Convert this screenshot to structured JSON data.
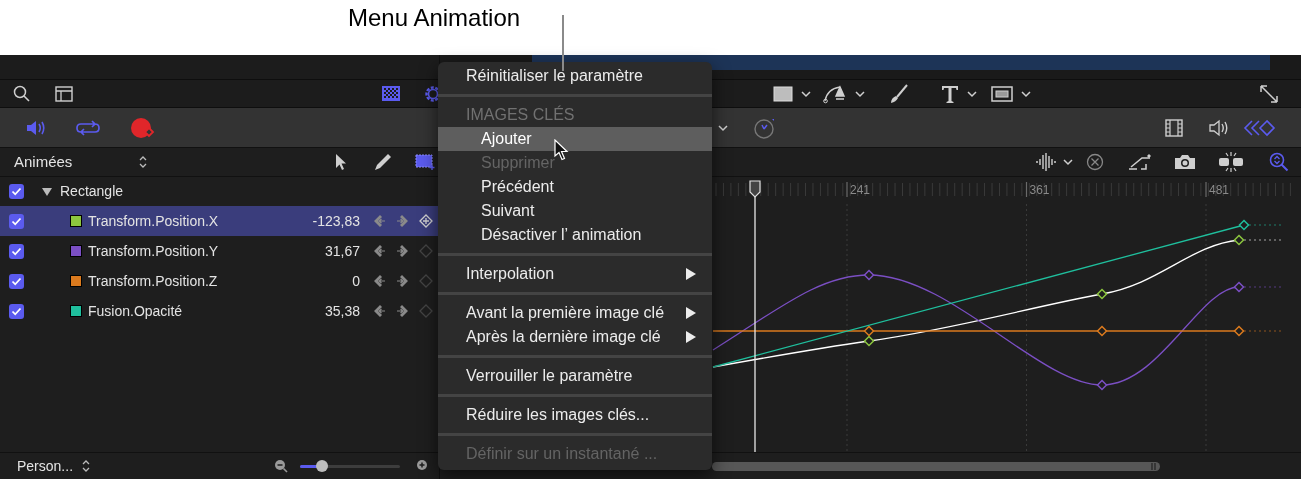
{
  "callout": {
    "label": "Menu Animation"
  },
  "parameter_list": {
    "filter": "Animées",
    "group": {
      "name": "Rectangle",
      "checked": true,
      "expanded": true
    },
    "parameters": [
      {
        "name": "Transform.Position.X",
        "value": "-123,83",
        "color": "#8cc63e",
        "checked": true,
        "selected": true
      },
      {
        "name": "Transform.Position.Y",
        "value": "31,67",
        "color": "#7b4fc4",
        "checked": true,
        "selected": false
      },
      {
        "name": "Transform.Position.Z",
        "value": "0",
        "color": "#db7a1e",
        "checked": true,
        "selected": false
      },
      {
        "name": "Fusion.Opacité",
        "value": "35,38",
        "color": "#1fbf9d",
        "checked": true,
        "selected": false
      }
    ]
  },
  "bottom_bar": {
    "preset": "Person...",
    "zoom": {
      "level": 0.22
    }
  },
  "ruler": {
    "labels": [
      "241",
      "361",
      "481"
    ]
  },
  "menu": [
    {
      "kind": "item",
      "label": "Réinitialiser le paramètre",
      "selected": false,
      "disabled": false,
      "submenu": false
    },
    {
      "kind": "separator"
    },
    {
      "kind": "section",
      "label": "IMAGES CLÉS",
      "children": [
        {
          "kind": "item",
          "label": "Ajouter",
          "selected": true,
          "disabled": false,
          "submenu": false
        },
        {
          "kind": "item",
          "label": "Supprimer",
          "selected": false,
          "disabled": true,
          "submenu": false
        },
        {
          "kind": "item",
          "label": "Précédent",
          "selected": false,
          "disabled": false,
          "submenu": false
        },
        {
          "kind": "item",
          "label": "Suivant",
          "selected": false,
          "disabled": false,
          "submenu": false
        },
        {
          "kind": "item",
          "label": "Désactiver l’ animation",
          "selected": false,
          "disabled": false,
          "submenu": false
        }
      ]
    },
    {
      "kind": "separator"
    },
    {
      "kind": "item",
      "label": "Interpolation",
      "selected": false,
      "disabled": false,
      "submenu": true
    },
    {
      "kind": "separator"
    },
    {
      "kind": "item",
      "label": "Avant la première image clé",
      "selected": false,
      "disabled": false,
      "submenu": true
    },
    {
      "kind": "item",
      "label": "Après la dernière image clé",
      "selected": false,
      "disabled": false,
      "submenu": true
    },
    {
      "kind": "separator"
    },
    {
      "kind": "item",
      "label": "Verrouiller le paramètre",
      "selected": false,
      "disabled": false,
      "submenu": false
    },
    {
      "kind": "separator"
    },
    {
      "kind": "item",
      "label": "Réduire les images clés...",
      "selected": false,
      "disabled": false,
      "submenu": false
    },
    {
      "kind": "separator"
    },
    {
      "kind": "item",
      "label": "Définir sur un instantané ...",
      "selected": false,
      "disabled": true,
      "submenu": false
    }
  ]
}
